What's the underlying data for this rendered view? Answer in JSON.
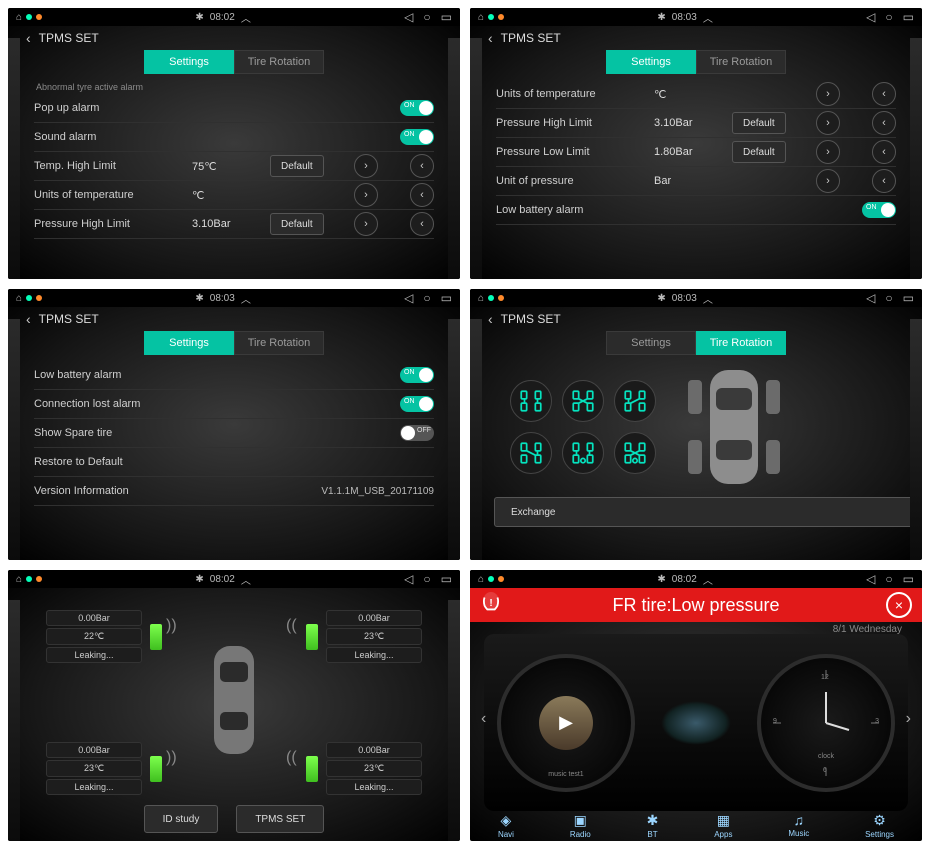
{
  "status": {
    "bt": "✱",
    "time_a": "08:02",
    "time_b": "08:03",
    "sys_back": "◁",
    "sys_home": "○",
    "sys_recent": "▭",
    "sys_up": "︿"
  },
  "common": {
    "title": "TPMS SET",
    "back": "‹",
    "tab_settings": "Settings",
    "tab_rotation": "Tire Rotation",
    "default": "Default",
    "next": "›",
    "prev": "‹"
  },
  "p1": {
    "hdr": "Abnormal tyre active alarm",
    "r1": "Pop up alarm",
    "r2": "Sound alarm",
    "r3": "Temp. High Limit",
    "r3v": "75℃",
    "r4": "Units of temperature",
    "r4v": "℃",
    "r5": "Pressure High Limit",
    "r5v": "3.10Bar"
  },
  "p2": {
    "r1": "Units of temperature",
    "r1v": "℃",
    "r2": "Pressure High Limit",
    "r2v": "3.10Bar",
    "r3": "Pressure Low Limit",
    "r3v": "1.80Bar",
    "r4": "Unit of pressure",
    "r4v": "Bar",
    "r5": "Low battery alarm"
  },
  "p3": {
    "r1": "Low battery alarm",
    "r2": "Connection lost alarm",
    "r3": "Show Spare tire",
    "r4": "Restore to Default",
    "r5": "Version Information",
    "r5v": "V1.1.1M_USB_20171109"
  },
  "p4": {
    "exchange": "Exchange"
  },
  "p5": {
    "tl_p": "0.00Bar",
    "tl_t": "22℃",
    "tl_s": "Leaking...",
    "tr_p": "0.00Bar",
    "tr_t": "23℃",
    "tr_s": "Leaking...",
    "bl_p": "0.00Bar",
    "bl_t": "23℃",
    "bl_s": "Leaking...",
    "br_p": "0.00Bar",
    "br_t": "23℃",
    "br_s": "Leaking...",
    "btn1": "ID study",
    "btn2": "TPMS SET"
  },
  "p6": {
    "alert": "FR tire:Low pressure",
    "close": "×",
    "date": "8/1 Wednesday",
    "song": "music test1",
    "clock": "clock",
    "nav": [
      "Navi",
      "Radio",
      "BT",
      "Apps",
      "Music",
      "Settings"
    ],
    "navicn": [
      "◈",
      "▣",
      "✱",
      "▦",
      "♫",
      "⚙"
    ]
  }
}
